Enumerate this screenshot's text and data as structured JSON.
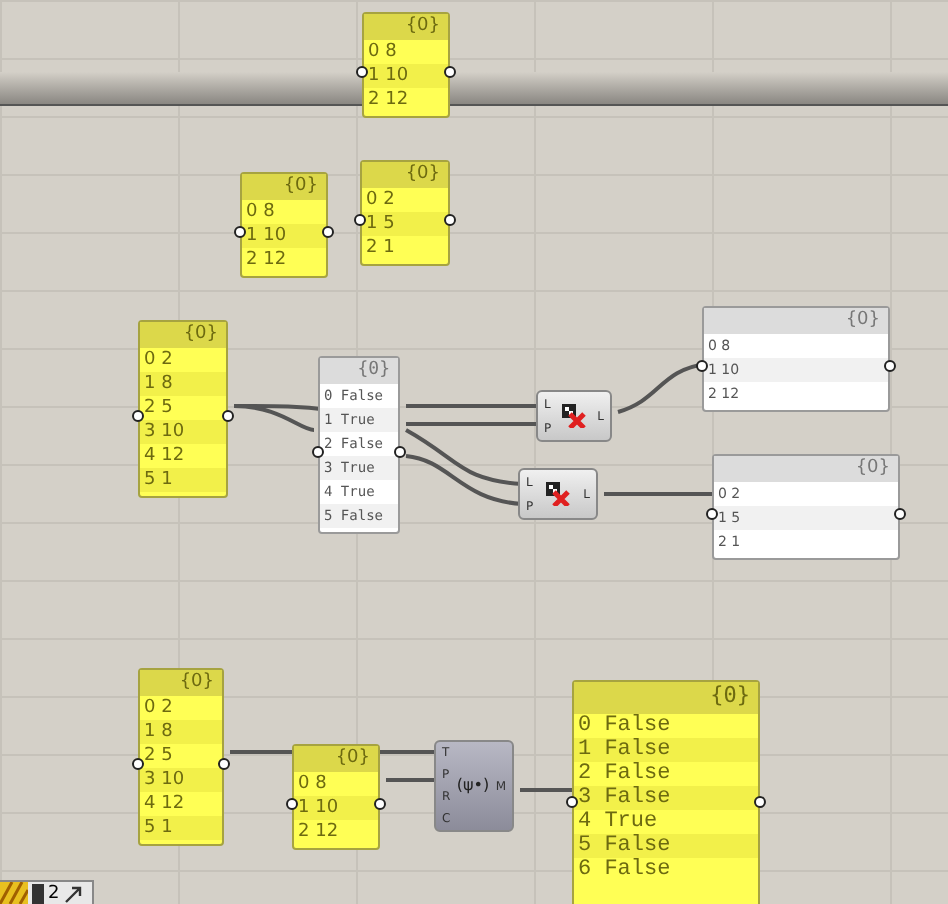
{
  "panels": [
    {
      "kind": "editable",
      "mono": false,
      "header": "{0}",
      "items": [
        {
          "index": "0",
          "value": "8"
        },
        {
          "index": "1",
          "value": "10"
        },
        {
          "index": "2",
          "value": "12"
        }
      ]
    },
    {
      "kind": "editable",
      "mono": false,
      "header": "{0}",
      "items": [
        {
          "index": "0",
          "value": "8"
        },
        {
          "index": "1",
          "value": "10"
        },
        {
          "index": "2",
          "value": "12"
        }
      ]
    },
    {
      "kind": "editable",
      "mono": false,
      "header": "{0}",
      "items": [
        {
          "index": "0",
          "value": "2"
        },
        {
          "index": "1",
          "value": "5"
        },
        {
          "index": "2",
          "value": "1"
        }
      ]
    },
    {
      "kind": "editable",
      "mono": false,
      "header": "{0}",
      "items": [
        {
          "index": "0",
          "value": "2"
        },
        {
          "index": "1",
          "value": "8"
        },
        {
          "index": "2",
          "value": "5"
        },
        {
          "index": "3",
          "value": "10"
        },
        {
          "index": "4",
          "value": "12"
        },
        {
          "index": "5",
          "value": "1"
        }
      ]
    },
    {
      "kind": "readonly",
      "mono": true,
      "header": "{0}",
      "items": [
        {
          "index": "0",
          "value": "False"
        },
        {
          "index": "1",
          "value": "True"
        },
        {
          "index": "2",
          "value": "False"
        },
        {
          "index": "3",
          "value": "True"
        },
        {
          "index": "4",
          "value": "True"
        },
        {
          "index": "5",
          "value": "False"
        }
      ]
    },
    {
      "kind": "readonly",
      "mono": false,
      "header": "{0}",
      "items": [
        {
          "index": "0",
          "value": "8"
        },
        {
          "index": "1",
          "value": "10"
        },
        {
          "index": "2",
          "value": "12"
        }
      ]
    },
    {
      "kind": "readonly",
      "mono": false,
      "header": "{0}",
      "items": [
        {
          "index": "0",
          "value": "2"
        },
        {
          "index": "1",
          "value": "5"
        },
        {
          "index": "2",
          "value": "1"
        }
      ]
    },
    {
      "kind": "editable",
      "mono": false,
      "header": "{0}",
      "items": [
        {
          "index": "0",
          "value": "2"
        },
        {
          "index": "1",
          "value": "8"
        },
        {
          "index": "2",
          "value": "5"
        },
        {
          "index": "3",
          "value": "10"
        },
        {
          "index": "4",
          "value": "12"
        },
        {
          "index": "5",
          "value": "1"
        }
      ]
    },
    {
      "kind": "editable",
      "mono": false,
      "header": "{0}",
      "items": [
        {
          "index": "0",
          "value": "8"
        },
        {
          "index": "1",
          "value": "10"
        },
        {
          "index": "2",
          "value": "12"
        }
      ]
    },
    {
      "kind": "editable",
      "mono": true,
      "header": "{0}",
      "items": [
        {
          "index": "0",
          "value": "False"
        },
        {
          "index": "1",
          "value": "False"
        },
        {
          "index": "2",
          "value": "False"
        },
        {
          "index": "3",
          "value": "False"
        },
        {
          "index": "4",
          "value": "True"
        },
        {
          "index": "5",
          "value": "False"
        },
        {
          "index": "6",
          "value": "False"
        }
      ]
    }
  ],
  "components": [
    {
      "kind": "icon",
      "inputs": [
        "L",
        "P"
      ],
      "outputs": [
        "L"
      ]
    },
    {
      "kind": "icon",
      "inputs": [
        "L",
        "P"
      ],
      "outputs": [
        "L"
      ]
    },
    {
      "kind": "label",
      "label": "(ψ•)",
      "inputs": [
        "T",
        "P",
        "R",
        "C"
      ],
      "outputs": [
        "M"
      ]
    }
  ],
  "toolbar": {
    "count": "2"
  }
}
